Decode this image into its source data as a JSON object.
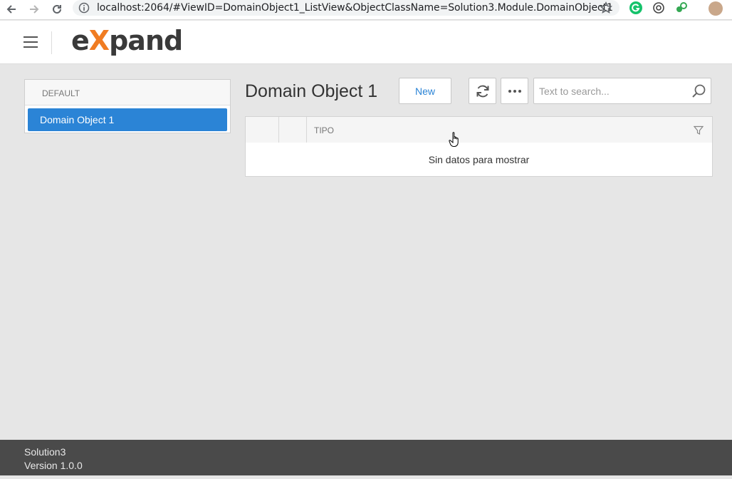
{
  "browser": {
    "url": "localhost:2064/#ViewID=DomainObject1_ListView&ObjectClassName=Solution3.Module.DomainObject1"
  },
  "header": {
    "logo_prefix": "e",
    "logo_x": "X",
    "logo_suffix": "pand"
  },
  "sidebar": {
    "group_label": "DEFAULT",
    "items": [
      {
        "label": "Domain Object 1",
        "selected": true
      }
    ]
  },
  "main": {
    "title": "Domain Object 1",
    "new_button_label": "New",
    "search_placeholder": "Text to search...",
    "grid": {
      "columns": [
        "TIPO"
      ],
      "empty_message": "Sin datos para mostrar"
    }
  },
  "footer": {
    "app_name": "Solution3",
    "version": "Version 1.0.0"
  },
  "colors": {
    "accent": "#2b84d6",
    "logo_orange": "#f07c22",
    "footer_bg": "#4a4a4a",
    "page_bg": "#e6e6e6"
  }
}
